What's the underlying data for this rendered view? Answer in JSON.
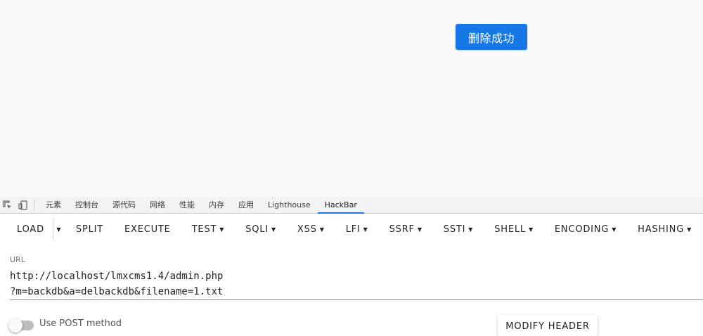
{
  "page": {
    "toast_text": "删除成功",
    "toast_color": "#1677e6"
  },
  "devtools": {
    "icons": [
      "inspect-element-icon",
      "device-toolbar-icon"
    ],
    "tabs": [
      {
        "label": "元素"
      },
      {
        "label": "控制台"
      },
      {
        "label": "源代码"
      },
      {
        "label": "网络"
      },
      {
        "label": "性能"
      },
      {
        "label": "内存"
      },
      {
        "label": "应用"
      },
      {
        "label": "Lighthouse"
      },
      {
        "label": "HackBar",
        "active": true
      }
    ],
    "accent": "#1a73e8"
  },
  "hackbar": {
    "load": "LOAD",
    "split": "SPLIT",
    "execute": "EXECUTE",
    "menus": [
      "TEST",
      "SQLI",
      "XSS",
      "LFI",
      "SSRF",
      "SSTI",
      "SHELL",
      "ENCODING",
      "HASHING"
    ],
    "url_label": "URL",
    "url_value": "http://localhost/lmxcms1.4/admin.php\n?m=backdb&a=delbackdb&filename=1.txt",
    "post_label": "Use POST method",
    "modify_header": "MODIFY HEADER"
  }
}
